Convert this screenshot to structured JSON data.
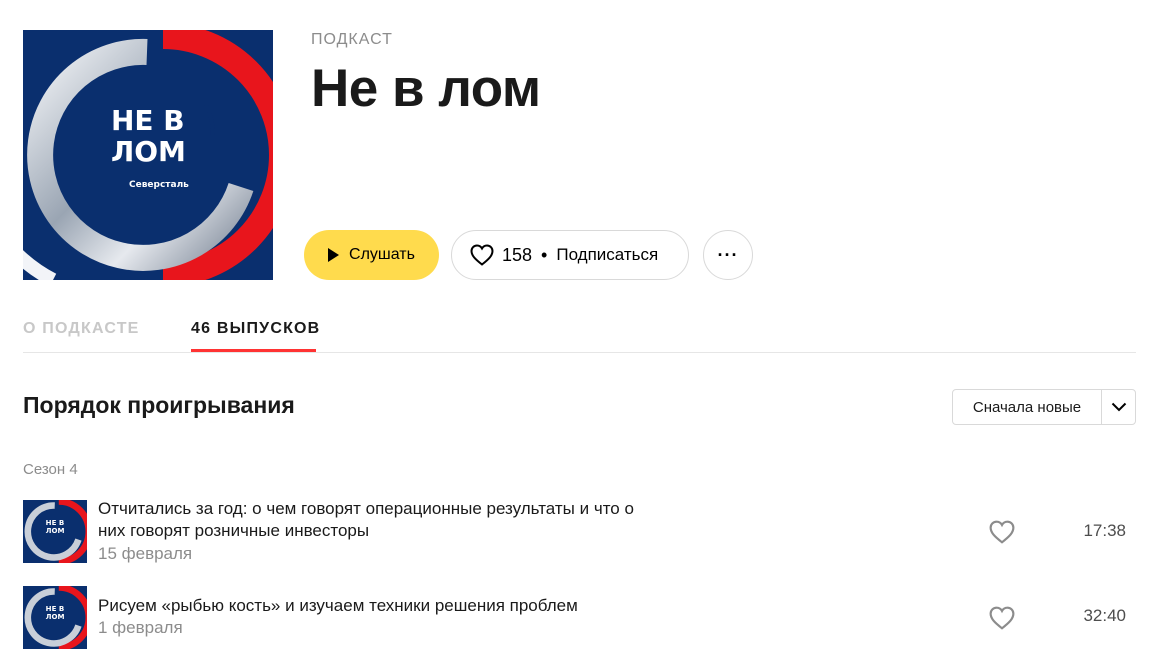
{
  "podcast": {
    "kind": "ПОДКАСТ",
    "title": "Не в лом",
    "cover": {
      "line1": "НЕ В",
      "line2": "ЛОМ",
      "brand": "Северсталь"
    }
  },
  "actions": {
    "listen_label": "Слушать",
    "likes_count": "158",
    "separator": "•",
    "subscribe_label": "Подписаться",
    "more_label": "···"
  },
  "tabs": [
    {
      "label": "О ПОДКАСТЕ",
      "active": false
    },
    {
      "label": "46 ВЫПУСКОВ",
      "active": true
    }
  ],
  "playback": {
    "heading": "Порядок проигрывания",
    "sort_value": "Сначала новые"
  },
  "season": {
    "label": "Сезон 4"
  },
  "episodes": [
    {
      "title": "Отчитались за год: о чем говорят операционные результаты и что о них говорят розничные инвесторы",
      "date": "15 февраля",
      "duration": "17:38"
    },
    {
      "title": "Рисуем «рыбью кость» и изучаем техники решения проблем",
      "date": "1 февраля",
      "duration": "32:40"
    }
  ],
  "colors": {
    "accent_yellow": "#ffdb4d",
    "tab_underline": "#ff3333",
    "cover_blue": "#0a2f6e",
    "cover_red": "#e8151c"
  },
  "icons": {
    "play": "play-icon",
    "heart": "heart-icon",
    "more": "more-dots-icon",
    "chevron": "chevron-down-icon"
  }
}
